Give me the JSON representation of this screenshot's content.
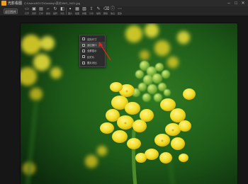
{
  "app": {
    "title": "光影看图",
    "file_path": "C:\\Users\\KDYD\\Desktop\\菜花\\IMG_0421.jpg"
  },
  "window_controls": [
    "–",
    "□",
    "✕"
  ],
  "toolbar": {
    "back_label": "返回图库",
    "tools": [
      {
        "icon": "folder-open-icon",
        "glyph": "▭",
        "label": "打开"
      },
      {
        "icon": "save-icon",
        "glyph": "▣",
        "label": "另存"
      },
      {
        "icon": "print-icon",
        "glyph": "▤",
        "label": "打印"
      },
      {
        "icon": "crop-icon",
        "glyph": "⌐",
        "label": "裁剪"
      },
      {
        "icon": "rotate-icon",
        "glyph": "↻",
        "label": "旋转"
      },
      {
        "icon": "compare-icon",
        "glyph": "◧",
        "label": "对比"
      },
      {
        "icon": "frame-icon",
        "glyph": "▪",
        "label": "图片",
        "active": true
      },
      {
        "icon": "crop-view-icon",
        "glyph": "▦",
        "label": "截图"
      },
      {
        "icon": "grid-icon",
        "glyph": "▧",
        "label": "拼图"
      },
      {
        "icon": "share-icon",
        "glyph": "⇪",
        "label": "分享"
      },
      {
        "icon": "edit-icon",
        "glyph": "✎",
        "label": "编辑"
      },
      {
        "icon": "delete-icon",
        "glyph": "⌫",
        "label": "删除"
      },
      {
        "icon": "info-icon",
        "glyph": "ⓘ",
        "label": "信息"
      },
      {
        "icon": "more-icon",
        "glyph": "⋯",
        "label": "更多"
      }
    ]
  },
  "dropdown": {
    "items": [
      {
        "label": "实际尺寸",
        "selected": false
      },
      {
        "label": "适应窗口",
        "selected": true
      },
      {
        "label": "全屏显示",
        "selected": false
      },
      {
        "label": "幻灯片",
        "selected": false
      },
      {
        "label": "图片对比",
        "selected": false
      }
    ]
  },
  "colors": {
    "accent_arrow": "#d42b1e",
    "bg_green_dark": "#0f3a12",
    "bg_green_light": "#3d8a2a",
    "petal_yellow": "#f2e32b",
    "bud_green": "#9bc83d"
  }
}
